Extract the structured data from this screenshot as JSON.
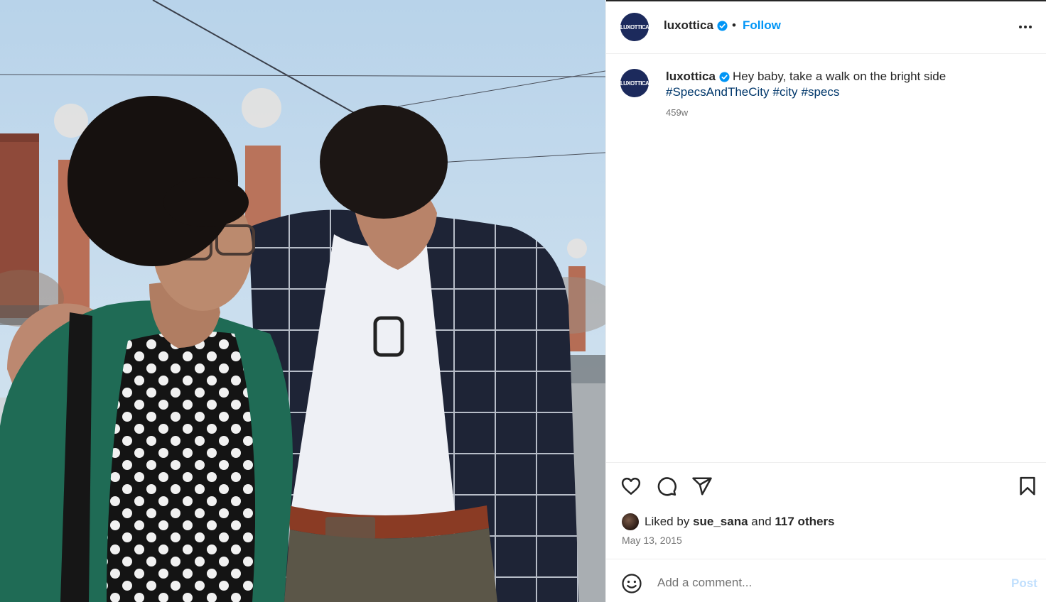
{
  "post": {
    "username": "luxottica",
    "avatar_text": "LUXOTTICA",
    "follow_label": "Follow",
    "separator": "•",
    "caption": "Hey baby, take a walk on the bright side",
    "hashtags": [
      "#SpecsAndTheCity",
      "#city",
      "#specs"
    ],
    "age": "459w",
    "liked_by_prefix": "Liked by",
    "liked_by_user": "sue_sana",
    "liked_by_and": "and",
    "liked_by_others": "117 others",
    "date": "May 13, 2015"
  },
  "comment": {
    "placeholder": "Add a comment...",
    "post_label": "Post"
  },
  "icons": {
    "more": "more-horizontal-icon",
    "verified": "verified-badge-icon",
    "like": "heart-icon",
    "comment": "comment-bubble-icon",
    "share": "paper-plane-icon",
    "save": "bookmark-icon",
    "emoji": "emoji-smile-icon"
  },
  "colors": {
    "link": "#0095f6",
    "hashtag": "#00376b",
    "post_disabled": "#c0dffd",
    "avatar_bg": "#1c2a5c"
  }
}
